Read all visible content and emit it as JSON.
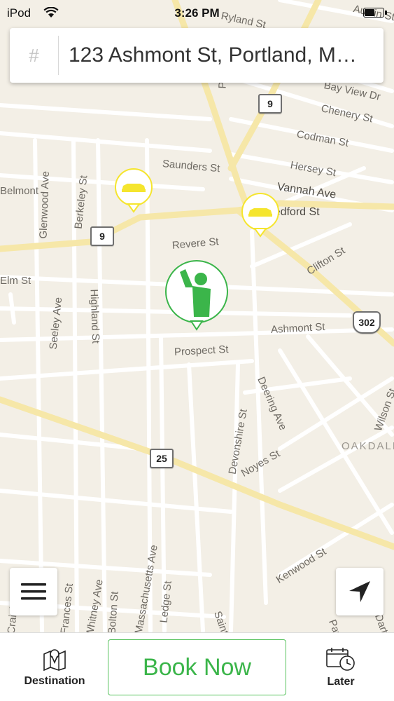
{
  "status_bar": {
    "carrier": "iPod",
    "time": "3:26 PM"
  },
  "search": {
    "hash_symbol": "#",
    "address": "123 Ashmont St, Portland, M…"
  },
  "map": {
    "streets": [
      "Ryland St",
      "Austin St",
      "Bay View Dr",
      "Chenery St",
      "Codman St",
      "Hersey St",
      "Vannah Ave",
      "Saunders St",
      "Bedford St",
      "Revere St",
      "Clifton St",
      "Ashmont St",
      "Prospect St",
      "Deering Ave",
      "Devonshire St",
      "Noyes St",
      "Kenwood St",
      "Glenwood Ave",
      "Berkeley St",
      "Highland St",
      "Seeley Ave",
      "Whitney Ave",
      "Frances St",
      "Craigie St",
      "Bolton St",
      "Massachusetts Ave",
      "Saint",
      "Payson St",
      "Wilson St",
      "Belmont",
      "Elm St",
      "Ledge St",
      "Dartmouth St",
      "Pine St"
    ],
    "route_shields": [
      "9",
      "9",
      "302",
      "25"
    ],
    "area_label": "OAKDALE",
    "accent_color": "#3bb54a",
    "taxi_color": "#f5e52e"
  },
  "controls": {
    "menu_icon": "hamburger-menu-icon",
    "locate_icon": "location-arrow-icon"
  },
  "bottom_bar": {
    "destination_label": "Destination",
    "book_label": "Book Now",
    "later_label": "Later"
  }
}
